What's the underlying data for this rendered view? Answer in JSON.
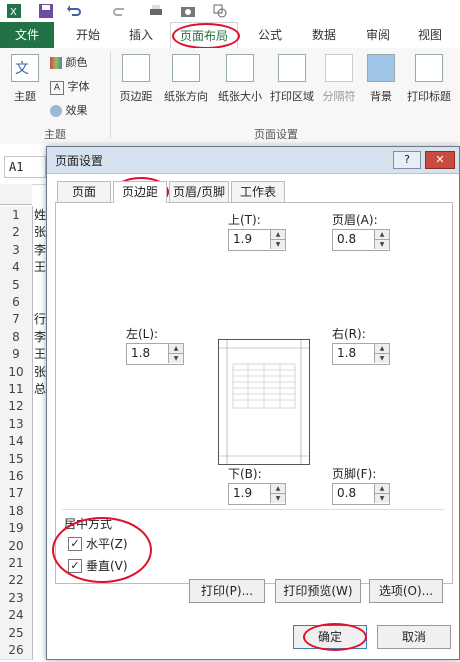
{
  "tabs": [
    "文件",
    "开始",
    "插入",
    "页面布局",
    "公式",
    "数据",
    "审阅",
    "视图"
  ],
  "ribbon": {
    "theme_group": {
      "theme": "主题",
      "colors": "颜色",
      "fonts": "字体",
      "effects": "效果",
      "label": "主题"
    },
    "setup_group": {
      "margins": "页边距",
      "orientation": "纸张方向",
      "size": "纸张大小",
      "print_area": "打印区域",
      "breaks": "分隔符",
      "background": "背景",
      "print_titles": "打印标题",
      "label": "页面设置"
    }
  },
  "namebox": "A1",
  "rows": [
    "1",
    "2",
    "3",
    "4",
    "5",
    "6",
    "7",
    "8",
    "9",
    "10",
    "11",
    "12",
    "13",
    "14",
    "15",
    "16",
    "17",
    "18",
    "19",
    "20",
    "21",
    "22",
    "23",
    "24",
    "25",
    "26"
  ],
  "cell_fragments": [
    "姓",
    "张",
    "李",
    "王",
    "",
    "",
    "行",
    "李",
    "王",
    "张",
    "总"
  ],
  "dialog": {
    "title": "页面设置",
    "help": "?",
    "close": "✕",
    "tabs": [
      "页面",
      "页边距",
      "页眉/页脚",
      "工作表"
    ],
    "fields": {
      "top": {
        "label": "上(T):",
        "value": "1.9"
      },
      "header": {
        "label": "页眉(A):",
        "value": "0.8"
      },
      "left": {
        "label": "左(L):",
        "value": "1.8"
      },
      "right": {
        "label": "右(R):",
        "value": "1.8"
      },
      "bottom": {
        "label": "下(B):",
        "value": "1.9"
      },
      "footer": {
        "label": "页脚(F):",
        "value": "0.8"
      }
    },
    "center_section": "居中方式",
    "horizontal": "水平(Z)",
    "vertical": "垂直(V)",
    "buttons": {
      "print": "打印(P)...",
      "preview": "打印预览(W)",
      "options": "选项(O)...",
      "ok": "确定",
      "cancel": "取消"
    }
  },
  "colors": {
    "accent": "#217346",
    "highlight_circle": "#e0102a",
    "title_bar": "#d6e2ef"
  },
  "icons": [
    "save-icon",
    "undo-icon",
    "redo-icon",
    "print-icon",
    "camera-icon",
    "shapes-icon"
  ]
}
